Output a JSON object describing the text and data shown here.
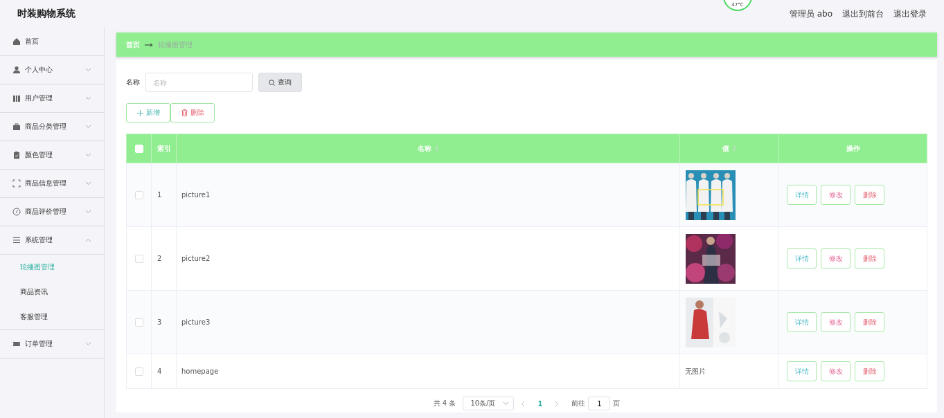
{
  "header": {
    "title": "时装购物系统",
    "temperature": "47°C",
    "user": "管理员 abo",
    "links": [
      "退出到前台",
      "退出登录"
    ]
  },
  "sidebar": {
    "items": [
      {
        "label": "首页"
      },
      {
        "label": "个人中心",
        "expanded": false
      },
      {
        "label": "用户管理",
        "expanded": false
      },
      {
        "label": "商品分类管理",
        "expanded": false
      },
      {
        "label": "颜色管理",
        "expanded": false
      },
      {
        "label": "商品信息管理",
        "expanded": false
      },
      {
        "label": "商品评价管理",
        "expanded": false
      },
      {
        "label": "系统管理",
        "expanded": true,
        "children": [
          {
            "label": "轮播图管理",
            "selected": true
          },
          {
            "label": "商品资讯",
            "selected": false
          },
          {
            "label": "客服管理",
            "selected": false
          }
        ]
      },
      {
        "label": "订单管理",
        "expanded": false
      }
    ]
  },
  "breadcrumb": [
    "首页",
    "轮播图管理"
  ],
  "search": {
    "label": "名称",
    "placeholder": "名称",
    "button": "查询"
  },
  "actions": [
    {
      "kind": "add",
      "label": "新增"
    },
    {
      "kind": "delete",
      "label": "删除"
    }
  ],
  "table": {
    "header_checked": false,
    "columns": [
      {
        "label": "索引",
        "sortable": false
      },
      {
        "label": "名称",
        "sortable": true
      },
      {
        "label": "值",
        "sortable": true
      },
      {
        "label": "操作",
        "sortable": false
      }
    ],
    "rows": [
      {
        "checked": false,
        "index": "1",
        "name": "picture1",
        "value": {
          "kind": "picture"
        },
        "actions": [
          {
            "kind": "detail",
            "label": "详情"
          },
          {
            "kind": "edit",
            "label": "修改"
          },
          {
            "kind": "delete",
            "label": "删除"
          }
        ]
      },
      {
        "checked": false,
        "index": "2",
        "name": "picture2",
        "value": {
          "kind": "picture"
        },
        "actions": [
          {
            "kind": "detail",
            "label": "详情"
          },
          {
            "kind": "edit",
            "label": "修改"
          },
          {
            "kind": "delete",
            "label": "删除"
          }
        ]
      },
      {
        "checked": false,
        "index": "3",
        "name": "picture3",
        "value": {
          "kind": "picture"
        },
        "actions": [
          {
            "kind": "detail",
            "label": "详情"
          },
          {
            "kind": "edit",
            "label": "修改"
          },
          {
            "kind": "delete",
            "label": "删除"
          }
        ]
      },
      {
        "checked": false,
        "index": "4",
        "name": "homepage",
        "value": {
          "kind": "text",
          "text": "无图片"
        },
        "actions": [
          {
            "kind": "detail",
            "label": "详情"
          },
          {
            "kind": "edit",
            "label": "修改"
          },
          {
            "kind": "delete",
            "label": "删除"
          }
        ]
      }
    ]
  },
  "pagination": {
    "total": "共 4 条",
    "page_size": "10条/页",
    "pages": [
      {
        "label": "1",
        "selected": true
      }
    ],
    "goto_label": "前往",
    "goto_value": "1",
    "goto_suffix": "页"
  }
}
